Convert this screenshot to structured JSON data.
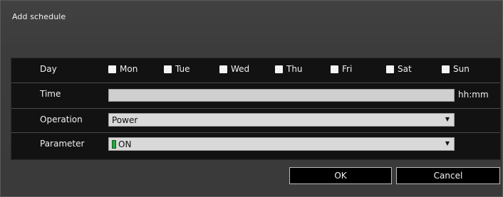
{
  "dialog": {
    "title": "Add schedule"
  },
  "form": {
    "day": {
      "label": "Day",
      "options": [
        {
          "label": "Mon",
          "checked": true
        },
        {
          "label": "Tue",
          "checked": true
        },
        {
          "label": "Wed",
          "checked": true
        },
        {
          "label": "Thu",
          "checked": true
        },
        {
          "label": "Fri",
          "checked": true
        },
        {
          "label": "Sat",
          "checked": true
        },
        {
          "label": "Sun",
          "checked": true
        }
      ]
    },
    "time": {
      "label": "Time",
      "value": "",
      "unit": "hh:mm"
    },
    "operation": {
      "label": "Operation",
      "value": "Power"
    },
    "parameter": {
      "label": "Parameter",
      "value": "ON"
    }
  },
  "buttons": {
    "ok": "OK",
    "cancel": "Cancel"
  },
  "colors": {
    "panel": "#121212",
    "led": "#22aa3a",
    "field": "#d9d9d9"
  },
  "icons": {
    "dropdown": "triangle-down",
    "status": "green-led"
  }
}
